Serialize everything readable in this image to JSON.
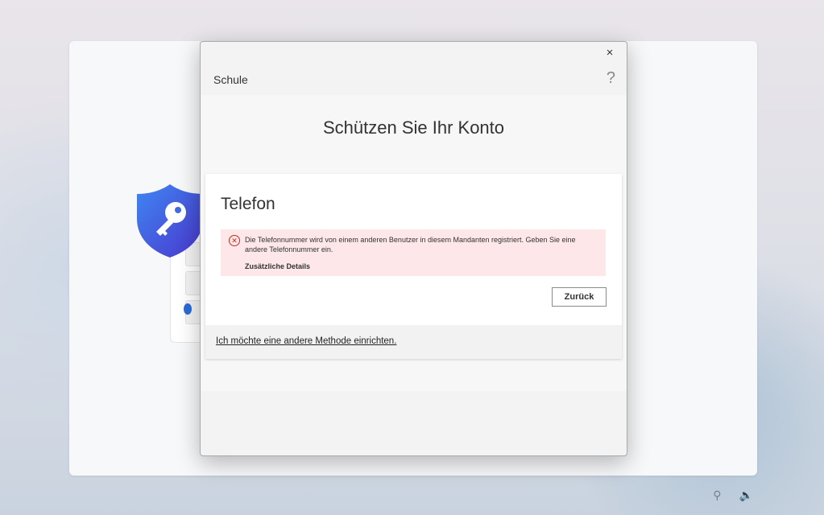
{
  "dialog": {
    "tenant_name": "Schule",
    "close_icon": "×",
    "help_icon": "?",
    "page_title": "Schützen Sie Ihr Konto",
    "card": {
      "title": "Telefon",
      "error": {
        "icon": "✕",
        "message": "Die Telefonnummer wird von einem anderen Benutzer in diesem Mandanten registriert. Geben Sie eine andere Telefonnummer ein.",
        "details_label": "Zusätzliche Details"
      },
      "back_button_label": "Zurück",
      "alt_method_link": "Ich möchte eine andere Methode einrichten."
    }
  },
  "taskbar": {
    "accessibility_icon": "⚲",
    "volume_icon": "🔈"
  },
  "colors": {
    "error_background": "#fde7e9",
    "error_icon": "#c42b1c",
    "shield_top": "#3b7cf0",
    "shield_bottom": "#4b3ed0"
  }
}
